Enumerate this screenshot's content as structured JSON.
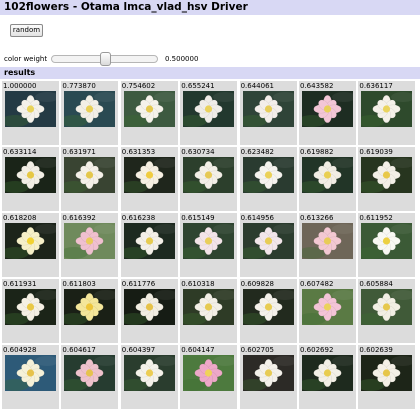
{
  "header": {
    "title": "102flowers - Otama lmca_vlad_hsv Driver"
  },
  "controls": {
    "random_label": "random",
    "weight_label": "color weight",
    "weight_value": "0.500000",
    "weight_fraction": 0.5
  },
  "results": {
    "heading": "results",
    "items": [
      {
        "score": "1.000000",
        "bg": "#243a44",
        "petal": "#f4f1ea",
        "center": "#e9d35a"
      },
      {
        "score": "0.773870",
        "bg": "#2a4a52",
        "petal": "#f2efe6",
        "center": "#e8cf55"
      },
      {
        "score": "0.754602",
        "bg": "#3d5a40",
        "petal": "#f5f2ea",
        "center": "#e4c84e"
      },
      {
        "score": "0.655241",
        "bg": "#22382e",
        "petal": "#efece8",
        "center": "#e9d15c"
      },
      {
        "score": "0.644061",
        "bg": "#2f4438",
        "petal": "#f3eeea",
        "center": "#e6cd5a"
      },
      {
        "score": "0.643582",
        "bg": "#1e2d22",
        "petal": "#f3c6d6",
        "center": "#e8d05a"
      },
      {
        "score": "0.636117",
        "bg": "#2e4a2c",
        "petal": "#f5f1e9",
        "center": "#ead45e"
      },
      {
        "score": "0.633114",
        "bg": "#1a2418",
        "petal": "#f2efe5",
        "center": "#e6c844"
      },
      {
        "score": "0.631971",
        "bg": "#394432",
        "petal": "#f4f0e8",
        "center": "#e4c74c"
      },
      {
        "score": "0.631353",
        "bg": "#1f261c",
        "petal": "#f6f0e2",
        "center": "#f0cc40"
      },
      {
        "score": "0.630734",
        "bg": "#2c3f2c",
        "petal": "#f3efe7",
        "center": "#e6c955"
      },
      {
        "score": "0.623482",
        "bg": "#2a3b30",
        "petal": "#f5f3ee",
        "center": "#ebd158"
      },
      {
        "score": "0.619882",
        "bg": "#223527",
        "petal": "#f1ede4",
        "center": "#e9cf52"
      },
      {
        "score": "0.619039",
        "bg": "#27351f",
        "petal": "#f3efe6",
        "center": "#e8c848"
      },
      {
        "score": "0.618208",
        "bg": "#1c241a",
        "petal": "#f6f0c8",
        "center": "#f1d232"
      },
      {
        "score": "0.616392",
        "bg": "#6f8a5c",
        "petal": "#f0c0cf",
        "center": "#eacb5a"
      },
      {
        "score": "0.616238",
        "bg": "#1d2a20",
        "petal": "#f4f0e8",
        "center": "#e6cb50"
      },
      {
        "score": "0.615149",
        "bg": "#2e4430",
        "petal": "#f3e4e8",
        "center": "#e9ce5a"
      },
      {
        "score": "0.614956",
        "bg": "#2b3c2e",
        "petal": "#f2e6ea",
        "center": "#e7cc55"
      },
      {
        "score": "0.613266",
        "bg": "#6e6658",
        "petal": "#f3c8d2",
        "center": "#e8cc58"
      },
      {
        "score": "0.611952",
        "bg": "#3b5a36",
        "petal": "#f8f8f2",
        "center": "#ecd040"
      },
      {
        "score": "0.611931",
        "bg": "#1b2418",
        "petal": "#f5f0e4",
        "center": "#e9c846"
      },
      {
        "score": "0.611803",
        "bg": "#1a2016",
        "petal": "#f4e69a",
        "center": "#eec63a"
      },
      {
        "score": "0.611776",
        "bg": "#161c14",
        "petal": "#f1ede2",
        "center": "#e6c24a"
      },
      {
        "score": "0.610318",
        "bg": "#2e3b26",
        "petal": "#f3efe6",
        "center": "#e6ca50"
      },
      {
        "score": "0.609828",
        "bg": "#222a1e",
        "petal": "#f4f1ea",
        "center": "#e8cc52"
      },
      {
        "score": "0.607482",
        "bg": "#5a7a44",
        "petal": "#f3c4d6",
        "center": "#ebd25c"
      },
      {
        "score": "0.605884",
        "bg": "#405a38",
        "petal": "#f2efe4",
        "center": "#e6c84c"
      },
      {
        "score": "0.604928",
        "bg": "#2d5a78",
        "petal": "#f5f1d8",
        "center": "#e6c24a"
      },
      {
        "score": "0.604617",
        "bg": "#263c30",
        "petal": "#eec2cc",
        "center": "#e6c24e"
      },
      {
        "score": "0.604397",
        "bg": "#2a3d2e",
        "petal": "#f4f2ea",
        "center": "#eccd54"
      },
      {
        "score": "0.604147",
        "bg": "#4d7a3e",
        "petal": "#eea8c8",
        "center": "#f0d25a"
      },
      {
        "score": "0.602705",
        "bg": "#2c2a26",
        "petal": "#f4f1ea",
        "center": "#e7cb55"
      },
      {
        "score": "0.602692",
        "bg": "#1e2a1e",
        "petal": "#f3efe6",
        "center": "#e8cc50"
      },
      {
        "score": "0.602639",
        "bg": "#1d2518",
        "petal": "#f4f0e6",
        "center": "#e6c64a"
      }
    ]
  }
}
